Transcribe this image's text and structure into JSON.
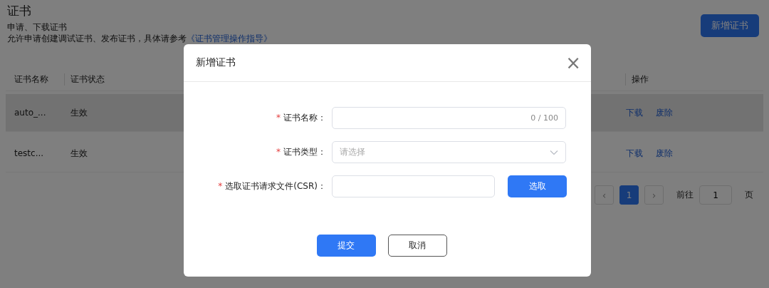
{
  "page": {
    "title": "证书",
    "subtitle": "申请、下载证书",
    "description": "允许申请创建调试证书、发布证书，具体请参考",
    "guide_link": "《证书管理操作指导》",
    "add_button": "新增证书"
  },
  "table": {
    "columns": [
      "证书名称",
      "证书状态"
    ],
    "action_column": "操作",
    "rows": [
      {
        "name": "auto_...",
        "status": "生效",
        "actions": [
          "下载",
          "废除"
        ],
        "hovered": true
      },
      {
        "name": "testc...",
        "status": "生效",
        "actions": [
          "下载",
          "废除"
        ],
        "hovered": false
      }
    ]
  },
  "pagination": {
    "prev": "‹",
    "pages": [
      {
        "label": "1",
        "selected": true
      }
    ],
    "next": "›",
    "goto_label": "前往",
    "goto_value": "1",
    "goto_suffix": "页"
  },
  "dialog": {
    "title": "新增证书",
    "close": "×",
    "fields": [
      {
        "kind": "text",
        "label": "证书名称：",
        "required": true,
        "required_mark": "*",
        "counter": "0 / 100"
      },
      {
        "kind": "select",
        "label": "证书类型：",
        "required": true,
        "required_mark": "*",
        "placeholder": "请选择"
      },
      {
        "kind": "file",
        "label": "选取证书请求文件(CSR)：",
        "required": true,
        "required_mark": "*",
        "button": "选取"
      }
    ],
    "submit": "提交",
    "cancel": "取消"
  }
}
